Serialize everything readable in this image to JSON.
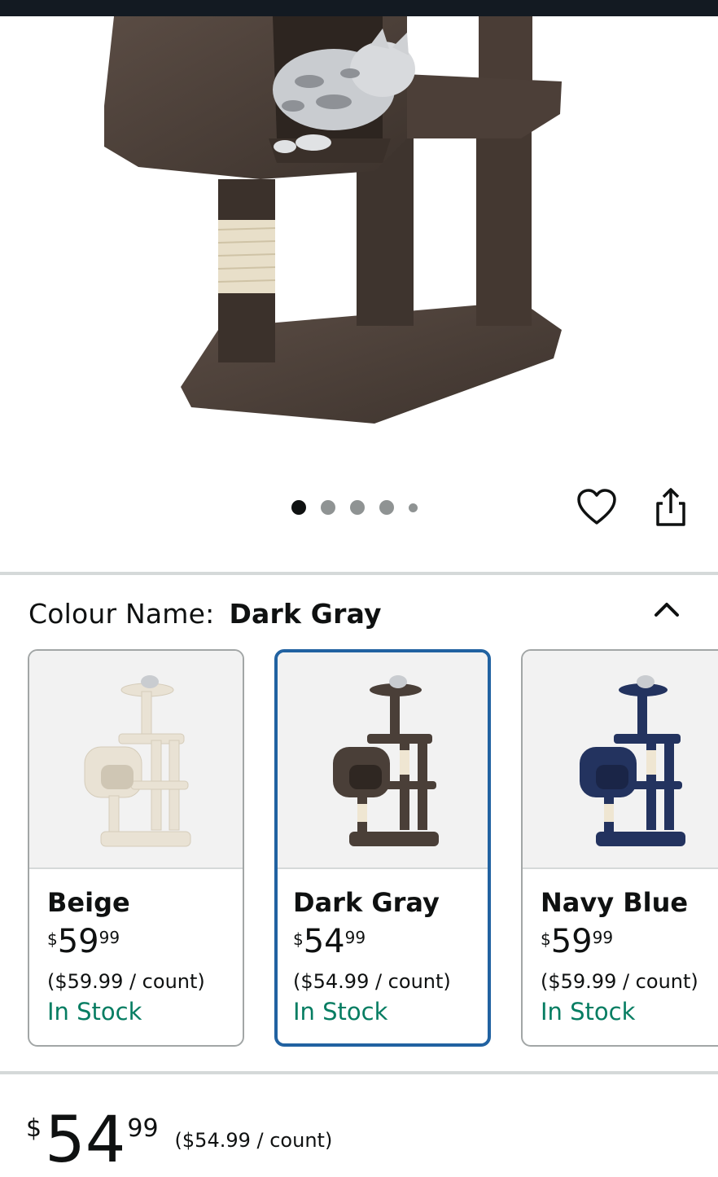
{
  "gallery": {
    "image_count": 5,
    "active_index": 0
  },
  "actions": {
    "wishlist_icon": "heart-icon",
    "share_icon": "share-icon"
  },
  "variant": {
    "label": "Colour Name:",
    "selected": "Dark Gray",
    "collapse_icon": "chevron-up-icon"
  },
  "options": [
    {
      "name": "Beige",
      "currency": "$",
      "whole": "59",
      "fraction": "99",
      "unit_price": "($59.99 / count)",
      "stock": "In Stock",
      "color": "#e9e2d4",
      "selected": false
    },
    {
      "name": "Dark Gray",
      "currency": "$",
      "whole": "54",
      "fraction": "99",
      "unit_price": "($54.99 / count)",
      "stock": "In Stock",
      "color": "#4a3f38",
      "selected": true
    },
    {
      "name": "Navy Blue",
      "currency": "$",
      "whole": "59",
      "fraction": "99",
      "unit_price": "($59.99 / count)",
      "stock": "In Stock",
      "color": "#23335f",
      "selected": false
    }
  ],
  "price": {
    "currency": "$",
    "whole": "54",
    "fraction": "99",
    "unit_price": "($54.99 / count)"
  },
  "colors": {
    "selected_border": "#2162a1",
    "in_stock": "#067d62"
  }
}
